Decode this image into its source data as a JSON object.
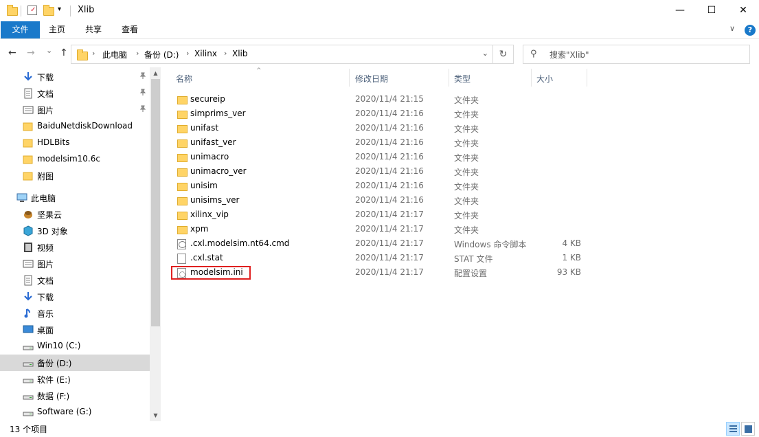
{
  "window": {
    "title": "Xlib",
    "minimize_glyph": "—",
    "maximize_glyph": "☐",
    "close_glyph": "✕"
  },
  "ribbon": {
    "tabs": [
      "文件",
      "主页",
      "共享",
      "查看"
    ],
    "expand_glyph": "∨",
    "help_glyph": "?"
  },
  "nav": {
    "back_glyph": "←",
    "forward_glyph": "→",
    "recent_glyph": "⌄",
    "up_glyph": "↑"
  },
  "address": {
    "breadcrumbs": [
      "此电脑",
      "备份 (D:)",
      "Xilinx",
      "Xlib"
    ],
    "separator": "›",
    "dropdown_glyph": "⌄",
    "refresh_glyph": "↻"
  },
  "search": {
    "placeholder": "搜索\"Xlib\"",
    "icon_glyph": "⚲"
  },
  "sidebar": {
    "items": [
      {
        "label": "下载",
        "icon": "download-icon",
        "pinned": true
      },
      {
        "label": "文档",
        "icon": "document-icon",
        "pinned": true
      },
      {
        "label": "图片",
        "icon": "picture-icon",
        "pinned": true
      },
      {
        "label": "BaiduNetdiskDownload",
        "icon": "folder-icon",
        "pinned": false
      },
      {
        "label": "HDLBits",
        "icon": "folder-icon",
        "pinned": false
      },
      {
        "label": "modelsim10.6c",
        "icon": "folder-icon",
        "pinned": false
      },
      {
        "label": "附图",
        "icon": "folder-icon",
        "pinned": false
      },
      {
        "label": "此电脑",
        "icon": "computer-icon",
        "pinned": false
      },
      {
        "label": "坚果云",
        "icon": "nutstore-icon",
        "pinned": false
      },
      {
        "label": "3D 对象",
        "icon": "3d-objects-icon",
        "pinned": false
      },
      {
        "label": "视频",
        "icon": "video-icon",
        "pinned": false
      },
      {
        "label": "图片",
        "icon": "picture-icon",
        "pinned": false
      },
      {
        "label": "文档",
        "icon": "document-icon",
        "pinned": false
      },
      {
        "label": "下载",
        "icon": "download-icon",
        "pinned": false
      },
      {
        "label": "音乐",
        "icon": "music-icon",
        "pinned": false
      },
      {
        "label": "桌面",
        "icon": "desktop-icon",
        "pinned": false
      },
      {
        "label": "Win10 (C:)",
        "icon": "drive-icon",
        "pinned": false
      },
      {
        "label": "备份 (D:)",
        "icon": "drive-icon",
        "pinned": false,
        "selected": true
      },
      {
        "label": "软件 (E:)",
        "icon": "drive-icon",
        "pinned": false
      },
      {
        "label": "数据 (F:)",
        "icon": "drive-icon",
        "pinned": false
      },
      {
        "label": "Software (G:)",
        "icon": "drive-icon",
        "pinned": false
      }
    ],
    "pin_glyph": "📌"
  },
  "filelist": {
    "columns": [
      "名称",
      "修改日期",
      "类型",
      "大小"
    ],
    "sort_glyph": "^",
    "rows": [
      {
        "name": "secureip",
        "date": "2020/11/4 21:15",
        "type": "文件夹",
        "size": "",
        "kind": "folder"
      },
      {
        "name": "simprims_ver",
        "date": "2020/11/4 21:16",
        "type": "文件夹",
        "size": "",
        "kind": "folder"
      },
      {
        "name": "unifast",
        "date": "2020/11/4 21:16",
        "type": "文件夹",
        "size": "",
        "kind": "folder"
      },
      {
        "name": "unifast_ver",
        "date": "2020/11/4 21:16",
        "type": "文件夹",
        "size": "",
        "kind": "folder"
      },
      {
        "name": "unimacro",
        "date": "2020/11/4 21:16",
        "type": "文件夹",
        "size": "",
        "kind": "folder"
      },
      {
        "name": "unimacro_ver",
        "date": "2020/11/4 21:16",
        "type": "文件夹",
        "size": "",
        "kind": "folder"
      },
      {
        "name": "unisim",
        "date": "2020/11/4 21:16",
        "type": "文件夹",
        "size": "",
        "kind": "folder"
      },
      {
        "name": "unisims_ver",
        "date": "2020/11/4 21:16",
        "type": "文件夹",
        "size": "",
        "kind": "folder"
      },
      {
        "name": "xilinx_vip",
        "date": "2020/11/4 21:17",
        "type": "文件夹",
        "size": "",
        "kind": "folder"
      },
      {
        "name": "xpm",
        "date": "2020/11/4 21:17",
        "type": "文件夹",
        "size": "",
        "kind": "folder"
      },
      {
        "name": ".cxl.modelsim.nt64.cmd",
        "date": "2020/11/4 21:17",
        "type": "Windows 命令脚本",
        "size": "4 KB",
        "kind": "cmd"
      },
      {
        "name": ".cxl.stat",
        "date": "2020/11/4 21:17",
        "type": "STAT 文件",
        "size": "1 KB",
        "kind": "file"
      },
      {
        "name": "modelsim.ini",
        "date": "2020/11/4 21:17",
        "type": "配置设置",
        "size": "93 KB",
        "kind": "ini"
      }
    ]
  },
  "status": {
    "item_count": "13 个项目"
  },
  "colors": {
    "accent": "#1979ca",
    "highlight": "#e02020",
    "selection": "#cce8ff"
  }
}
